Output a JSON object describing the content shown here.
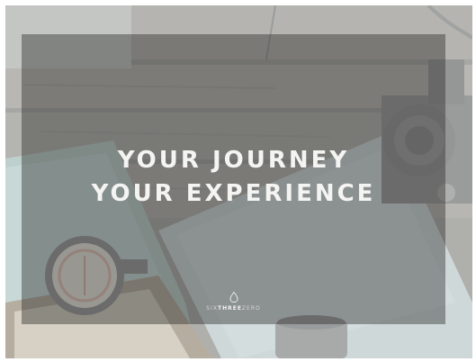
{
  "banner": {
    "headline_line1": "YOUR JOURNEY",
    "headline_line2": "YOUR EXPERIENCE"
  },
  "brand": {
    "part1": "SIX",
    "part2": "THREE",
    "part3": "ZERO"
  },
  "colors": {
    "overlay": "#2a2a28",
    "text": "#f4f4f2",
    "frost": "#ebf0f0"
  },
  "icons": {
    "logo_mark": "droplet-icon"
  }
}
